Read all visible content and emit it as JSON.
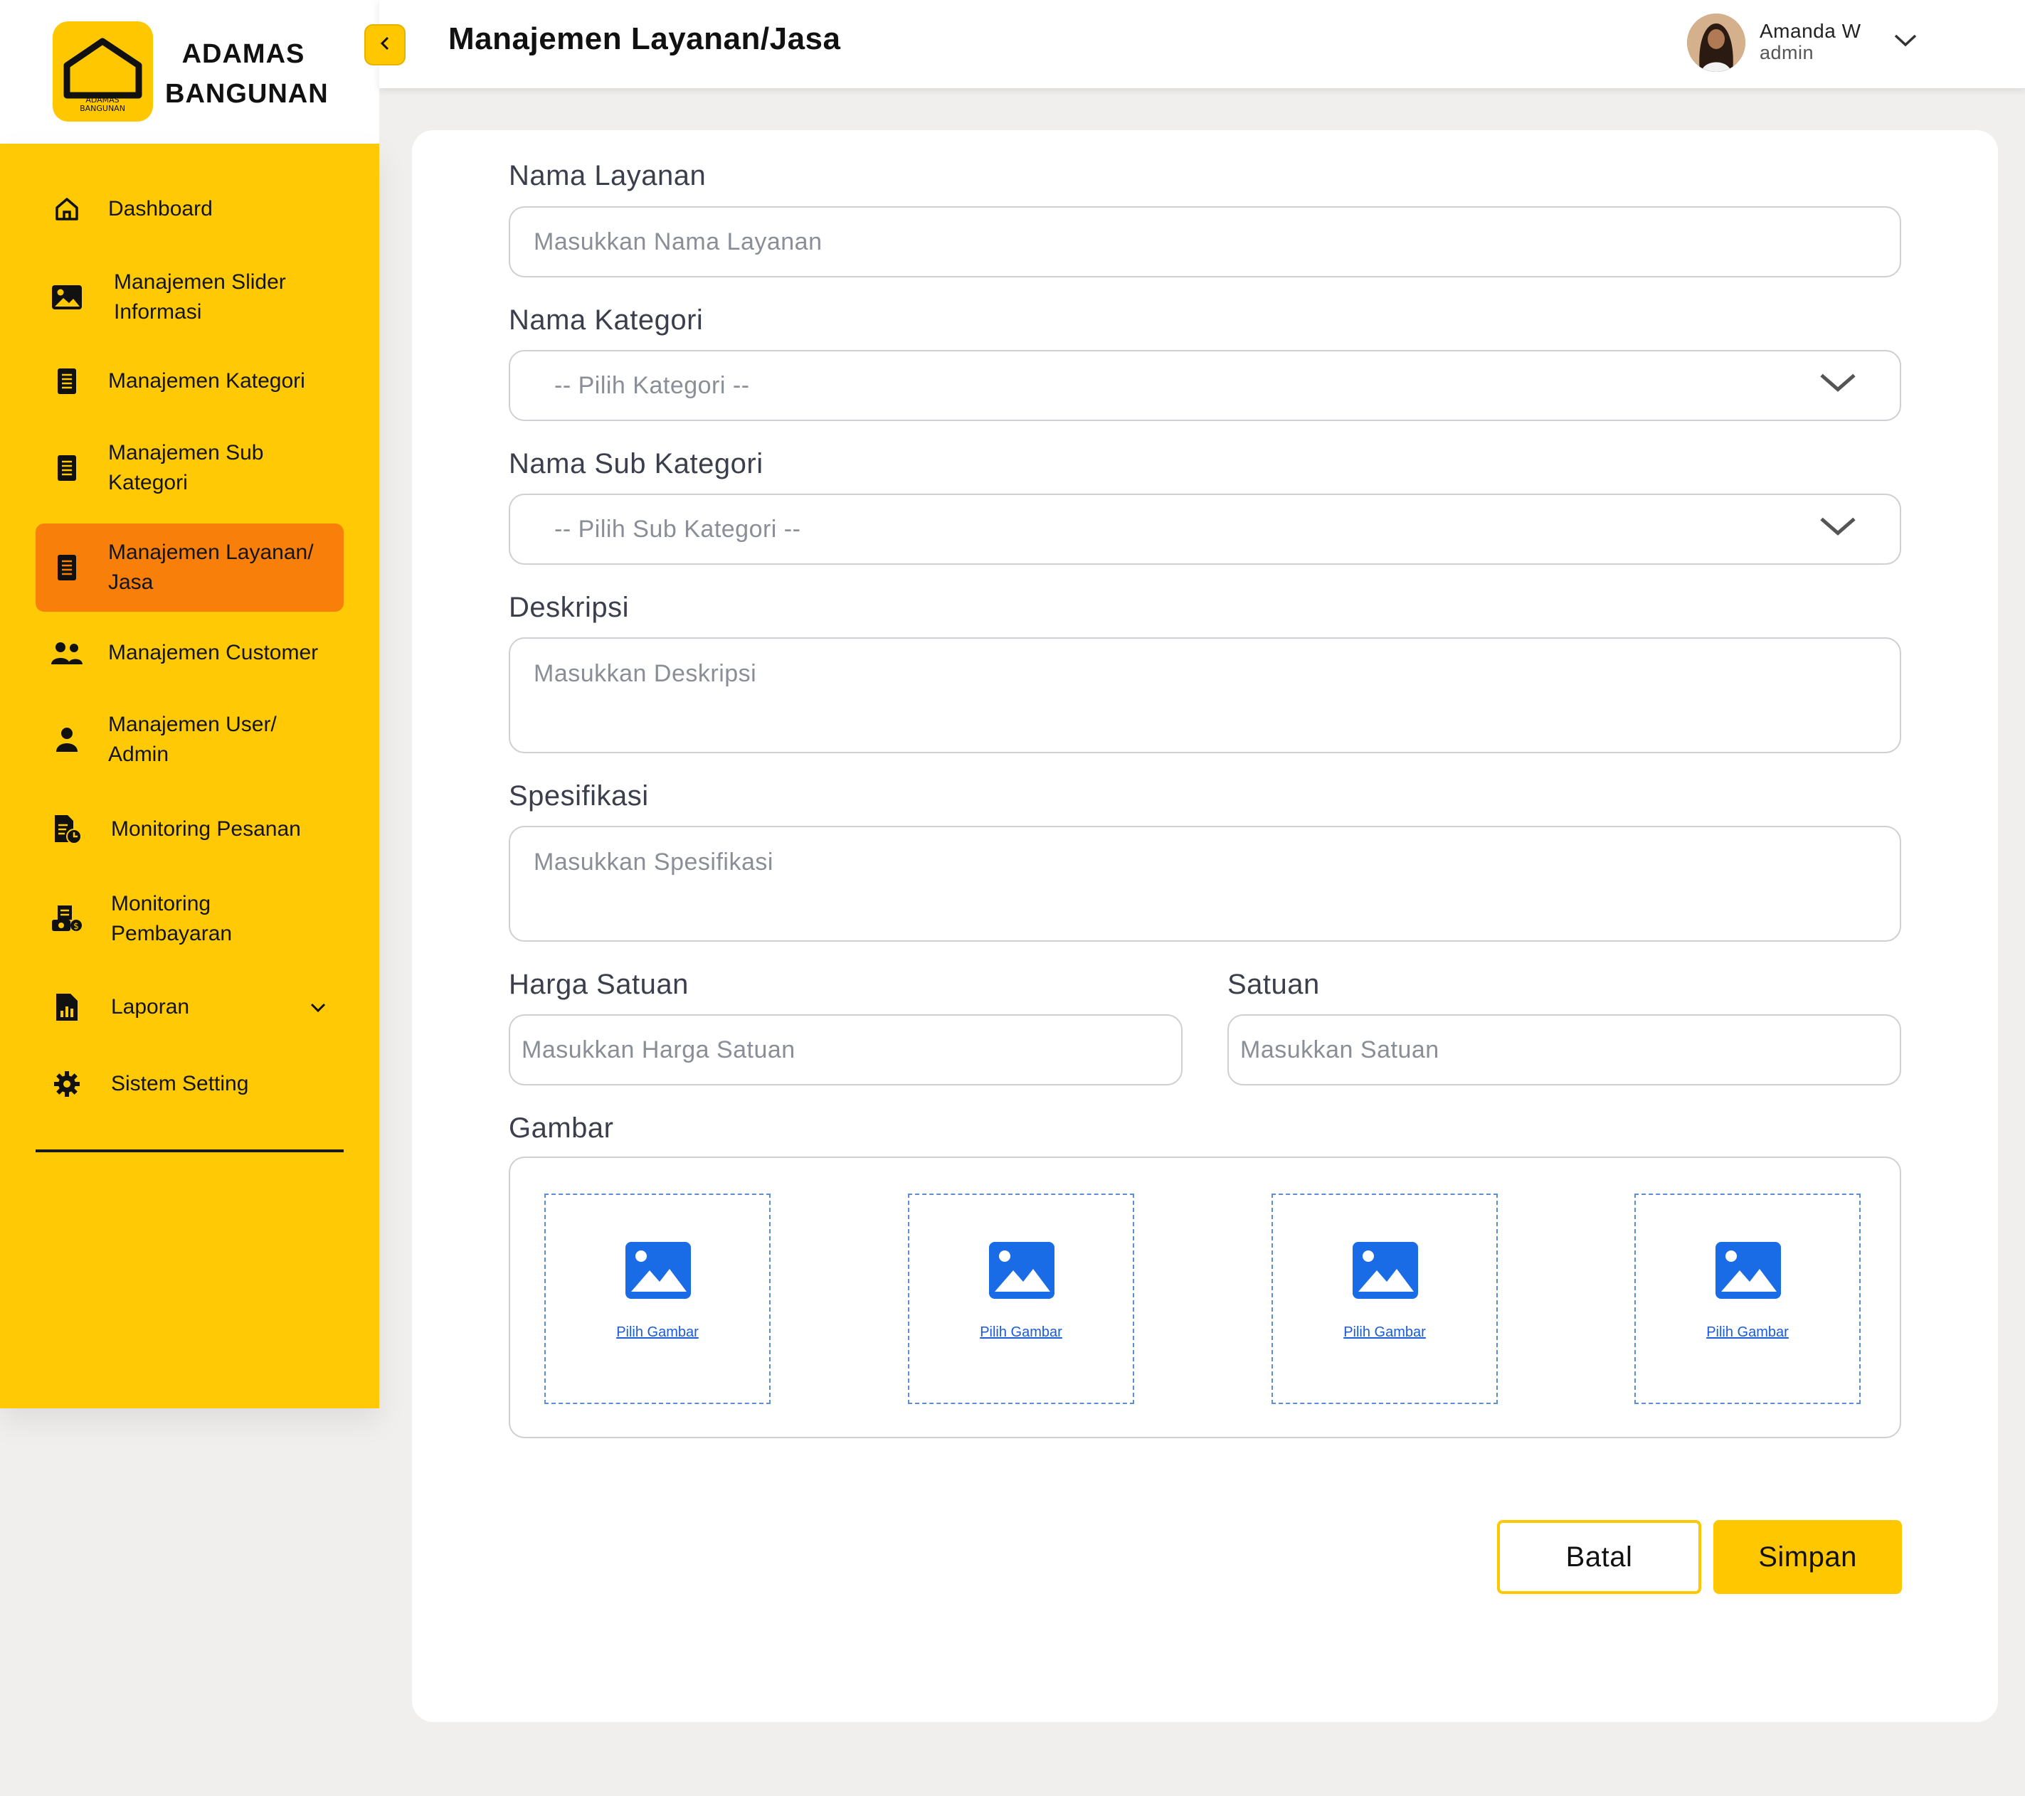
{
  "brand": {
    "name_line1": "ADAMAS",
    "name_line2": "BANGUNAN",
    "logo_line1": "ADAMAS",
    "logo_line2": "BANGUNAN"
  },
  "header": {
    "title": "Manajemen Layanan/Jasa"
  },
  "user": {
    "name": "Amanda W",
    "role": "admin"
  },
  "sidebar": {
    "items": [
      {
        "line1": "Dashboard",
        "line2": ""
      },
      {
        "line1": "Manajemen Slider",
        "line2": "Informasi"
      },
      {
        "line1": "Manajemen Kategori",
        "line2": ""
      },
      {
        "line1": "Manajemen Sub",
        "line2": "Kategori"
      },
      {
        "line1": "Manajemen Layanan/",
        "line2": "Jasa"
      },
      {
        "line1": "Manajemen Customer",
        "line2": ""
      },
      {
        "line1": "Manajemen User/",
        "line2": "Admin"
      },
      {
        "line1": "Monitoring Pesanan",
        "line2": ""
      },
      {
        "line1": "Monitoring",
        "line2": "Pembayaran"
      },
      {
        "line1": "Laporan",
        "line2": ""
      },
      {
        "line1": "Sistem Setting",
        "line2": ""
      }
    ],
    "active_index": 4
  },
  "form": {
    "nama_layanan": {
      "label": "Nama Layanan",
      "placeholder": "Masukkan Nama Layanan"
    },
    "kategori": {
      "label": "Nama Kategori",
      "selected": "-- Pilih Kategori --"
    },
    "sub_kategori": {
      "label": "Nama Sub Kategori",
      "selected": "-- Pilih Sub Kategori --"
    },
    "deskripsi": {
      "label": "Deskripsi",
      "placeholder": "Masukkan Deskripsi"
    },
    "spesifikasi": {
      "label": "Spesifikasi",
      "placeholder": "Masukkan Spesifikasi"
    },
    "harga": {
      "label": "Harga Satuan",
      "placeholder": "Masukkan Harga Satuan"
    },
    "satuan": {
      "label": "Satuan",
      "placeholder": "Masukkan Satuan"
    },
    "gambar": {
      "label": "Gambar",
      "slots": [
        "Pilih Gambar",
        "Pilih Gambar",
        "Pilih Gambar",
        "Pilih Gambar"
      ]
    }
  },
  "actions": {
    "cancel": "Batal",
    "save": "Simpan"
  },
  "colors": {
    "brand_yellow": "#FFC700",
    "sidebar_yellow": "#FFCA05",
    "active_orange": "#F77F0A",
    "link_blue": "#1A5BD9"
  },
  "icons": [
    "home-icon",
    "image-icon",
    "list-icon",
    "users-icon",
    "user-icon",
    "order-monitor-icon",
    "payment-monitor-icon",
    "report-icon",
    "gear-icon",
    "chevron-down-icon",
    "chevron-left-icon",
    "picture-icon"
  ]
}
